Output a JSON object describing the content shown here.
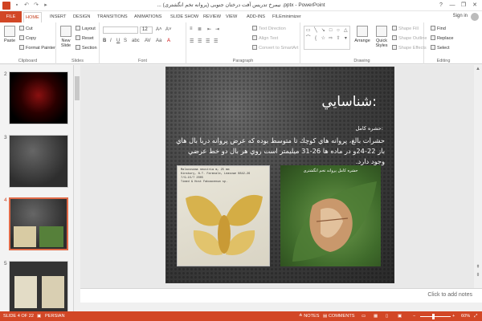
{
  "window": {
    "title": "... نیمرخ تدریس آفت درختان جنوبی (پروانه تخم انگشتری) .pptx - PowerPoint",
    "controls": [
      "?",
      "—",
      "❐",
      "✕"
    ]
  },
  "qat_icons": [
    "save-icon",
    "undo-icon",
    "redo-icon",
    "present-icon"
  ],
  "tabs": [
    "FILE",
    "HOME",
    "INSERT",
    "DESIGN",
    "TRANSITIONS",
    "ANIMATIONS",
    "SLIDE SHOW",
    "REVIEW",
    "VIEW",
    "ADD-INS",
    "FILEminimizer"
  ],
  "active_tab": "HOME",
  "account": {
    "signin": "Sign in"
  },
  "ribbon": {
    "clipboard": {
      "label": "Clipboard",
      "paste": "Paste",
      "cut": "Cut",
      "copy": "Copy",
      "format_painter": "Format Painter"
    },
    "slides": {
      "label": "Slides",
      "new_slide": "New Slide",
      "layout": "Layout",
      "reset": "Reset",
      "section": "Section"
    },
    "font": {
      "label": "Font",
      "size": "12"
    },
    "paragraph": {
      "label": "Paragraph",
      "text_direction": "Text Direction",
      "align_text": "Align Text",
      "convert_smartart": "Convert to SmartArt"
    },
    "drawing": {
      "label": "Drawing",
      "arrange": "Arrange",
      "quick_styles": "Quick Styles",
      "shape_fill": "Shape Fill",
      "shape_outline": "Shape Outline",
      "shape_effects": "Shape Effects"
    },
    "editing": {
      "label": "Editing",
      "find": "Find",
      "replace": "Replace",
      "select": "Select"
    }
  },
  "thumbnails": [
    {
      "num": "2"
    },
    {
      "num": "3"
    },
    {
      "num": "4"
    },
    {
      "num": "5"
    }
  ],
  "slide": {
    "title": ":شناسايي",
    "subhead": ":حشره كامل",
    "body": "حشرات بالغ، پروانه هاي كوچك تا متوسط بوده كه عرض پروانه دربا بال هاي باز 22-24و در ماده ها 26-31 ميليمتر است روي هر بال دو خط عرضي وجود دارد.",
    "photo1_label": "Malacosoma neustria m, 25 mm\nKinsbury, N.T. Farmvale, Leasowe 0842-26\n7/9-15/7 2005\nTimed & Host Faboacenum sp.",
    "photo2_caption": "حشره کامل پروانه تخم انگشتری"
  },
  "notes": {
    "placeholder": "Click to add notes"
  },
  "status": {
    "slide": "SLIDE 4 OF 22",
    "language": "PERSIAN",
    "notes": "NOTES",
    "comments": "COMMENTS",
    "zoom": "60%",
    "zoom_level": 0.6
  },
  "colors": {
    "accent": "#d24726",
    "slide_bg": "#3a3a3a"
  }
}
